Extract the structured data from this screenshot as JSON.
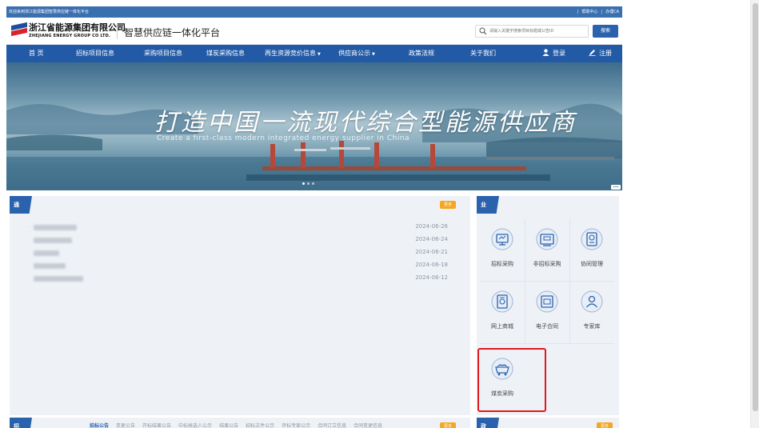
{
  "topbar": {
    "welcome": "欢迎来到浙江能源集团智慧供应链一体化平台",
    "links": [
      "帮助中心",
      "办理CA"
    ]
  },
  "header": {
    "company_cn": "浙江省能源集团有限公司",
    "company_en": "ZHEJIANG ENERGY GROUP CO LTD.",
    "platform": "智慧供应链一体化平台",
    "search_placeholder": "请输入关键字搜索项目标题或公告ID",
    "search_button": "搜索"
  },
  "nav": {
    "items": [
      {
        "label": "首  页",
        "caret": ""
      },
      {
        "label": "招标项目信息",
        "caret": ""
      },
      {
        "label": "采购项目信息",
        "caret": ""
      },
      {
        "label": "煤炭采购信息",
        "caret": ""
      },
      {
        "label": "再生资源竞价信息",
        "caret": "▼"
      },
      {
        "label": "供应商公示",
        "caret": "▼"
      },
      {
        "label": "政策法规",
        "caret": ""
      },
      {
        "label": "关于我们",
        "caret": ""
      }
    ],
    "login": "登录",
    "register": "注册"
  },
  "banner": {
    "slogan": "打造中国一流现代综合型能源供应商",
    "slogan_en": "Create a first-class modern integrated energy supplier in China"
  },
  "notices": {
    "title": "通知公告",
    "more": "更多",
    "items": [
      {
        "date": "2024-06-26"
      },
      {
        "date": "2024-06-24"
      },
      {
        "date": "2024-06-21"
      },
      {
        "date": "2024-06-18"
      },
      {
        "date": "2024-06-12"
      }
    ]
  },
  "business": {
    "title": "业务模块",
    "modules": [
      {
        "label": "招标采购",
        "icon": "bidding-procurement-icon"
      },
      {
        "label": "非招标采购",
        "icon": "non-bidding-procurement-icon"
      },
      {
        "label": "协同管理",
        "icon": "collaboration-icon"
      },
      {
        "label": "网上商城",
        "icon": "online-mall-icon"
      },
      {
        "label": "电子合同",
        "icon": "e-contract-icon"
      },
      {
        "label": "专家库",
        "icon": "expert-database-icon"
      },
      {
        "label": "煤炭采购",
        "icon": "coal-procurement-icon"
      }
    ]
  },
  "bid_info": {
    "title": "招标信息",
    "tabs": [
      "招标公告",
      "变更公告",
      "开标结果公告",
      "中标候选人公示",
      "结果公告",
      "招标文件公示",
      "评标专家公示",
      "合同订立信息",
      "合同变更信息"
    ],
    "more": "更多"
  },
  "policy": {
    "title": "政策法规",
    "more": "更多"
  },
  "colors": {
    "primary": "#235aa6",
    "accent": "#f5a623",
    "highlight": "#e0181e"
  }
}
